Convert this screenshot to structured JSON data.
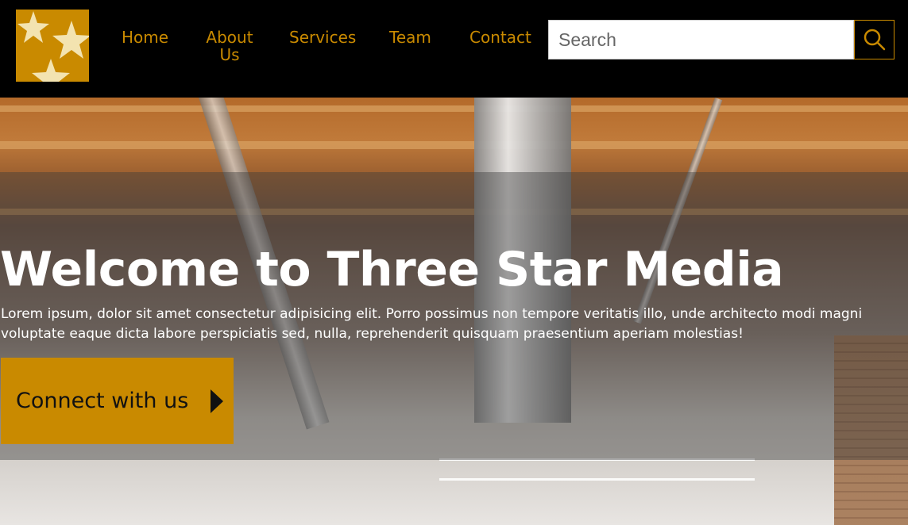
{
  "brand": {
    "logo_icon": "three-stars-logo",
    "logo_color": "#c98a00"
  },
  "nav": {
    "items": [
      {
        "label": "Home"
      },
      {
        "label": "About Us"
      },
      {
        "label": "Services"
      },
      {
        "label": "Team"
      },
      {
        "label": "Contact"
      }
    ]
  },
  "search": {
    "placeholder": "Search",
    "value": "",
    "icon": "search-icon"
  },
  "hero": {
    "title": "Welcome to Three Star Media",
    "description": "Lorem ipsum, dolor sit amet consectetur adipisicing elit. Porro possimus non tempore veritatis illo, unde architecto modi magni voluptate eaque dicta labore perspiciatis sed, nulla, reprehenderit quisquam praesentium aperiam molestias!",
    "cta_label": "Connect with us",
    "cta_icon": "play-arrow-icon"
  },
  "colors": {
    "accent": "#c98a00",
    "header_bg": "#000000",
    "text_on_dark": "#ffffff"
  }
}
